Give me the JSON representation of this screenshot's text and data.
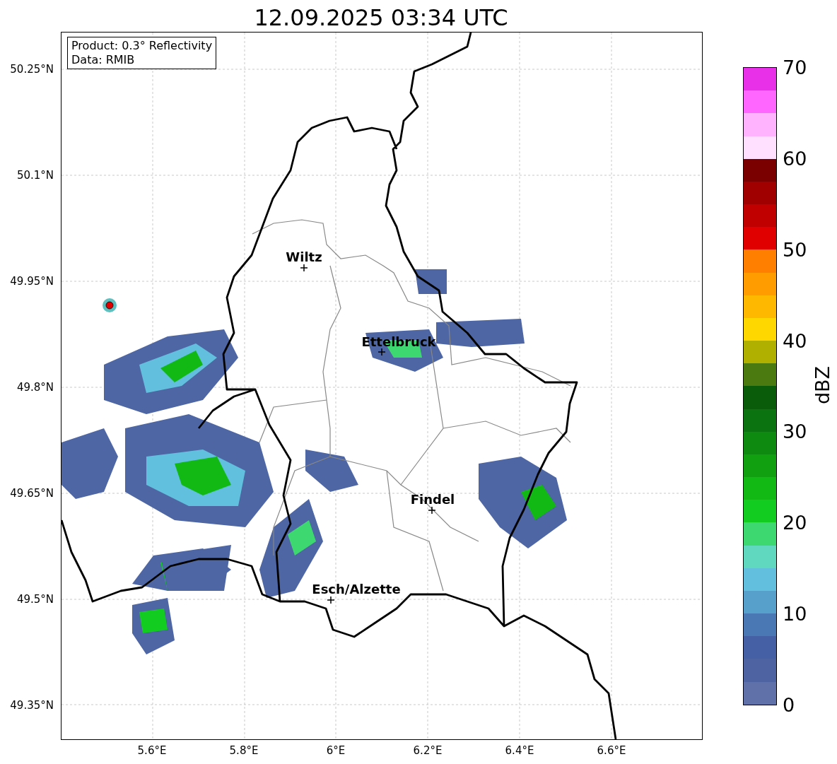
{
  "title": "12.09.2025 03:34 UTC",
  "legend": {
    "lines": [
      "Product: 0.3° Reflectivity",
      "Data: RMIB"
    ]
  },
  "cities": [
    {
      "name": "Wiltz"
    },
    {
      "name": "Ettelbruck"
    },
    {
      "name": "Findel"
    },
    {
      "name": "Esch/Alzette"
    }
  ],
  "lat_ticks": [
    "50.25°N",
    "50.1°N",
    "49.95°N",
    "49.8°N",
    "49.65°N",
    "49.5°N",
    "49.35°N"
  ],
  "lon_ticks": [
    "5.6°E",
    "5.8°E",
    "6°E",
    "6.2°E",
    "6.4°E",
    "6.6°E"
  ],
  "colorbar": {
    "label": "dBZ",
    "ticks": [
      "70",
      "60",
      "50",
      "40",
      "30",
      "20",
      "10",
      "0"
    ],
    "bins": [
      {
        "color": "#e930e9"
      },
      {
        "color": "#ff66ff"
      },
      {
        "color": "#ffb3ff"
      },
      {
        "color": "#ffe0ff"
      },
      {
        "color": "#7a0000"
      },
      {
        "color": "#a00000"
      },
      {
        "color": "#c00000"
      },
      {
        "color": "#e00000"
      },
      {
        "color": "#ff8000"
      },
      {
        "color": "#ff9c00"
      },
      {
        "color": "#ffb800"
      },
      {
        "color": "#ffd700"
      },
      {
        "color": "#b0b000"
      },
      {
        "color": "#4a7a10"
      },
      {
        "color": "#0a5c0a"
      },
      {
        "color": "#0b7410"
      },
      {
        "color": "#0e8a10"
      },
      {
        "color": "#10a010"
      },
      {
        "color": "#12b814"
      },
      {
        "color": "#12cc20"
      },
      {
        "color": "#3ed870"
      },
      {
        "color": "#60d8c0"
      },
      {
        "color": "#62c0de"
      },
      {
        "color": "#58a0cc"
      },
      {
        "color": "#4a78b4"
      },
      {
        "color": "#4560a4"
      },
      {
        "color": "#4e64a2"
      },
      {
        "color": "#6070a8"
      }
    ]
  }
}
